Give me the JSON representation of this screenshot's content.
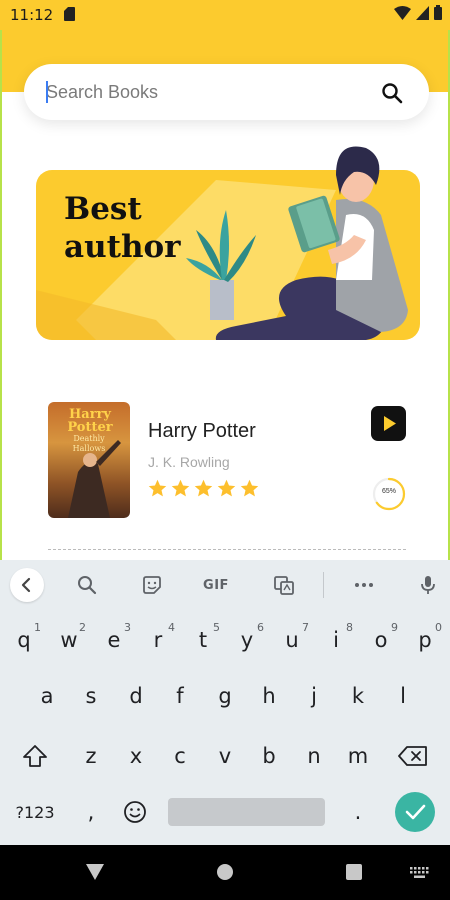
{
  "status_bar": {
    "time": "11:12"
  },
  "search": {
    "placeholder": "Search Books"
  },
  "banner": {
    "title_line1": "Best",
    "title_line2": "author"
  },
  "book": {
    "title": "Harry Potter",
    "author": "J. K. Rowling",
    "rating": 5,
    "progress_label": "65%",
    "progress_fraction": 0.65,
    "cover_title_line1": "Harry",
    "cover_title_line2": "Potter",
    "cover_subtitle": "Deathly Hallows"
  },
  "keyboard": {
    "gif_label": "GIF",
    "row1": [
      {
        "key": "q",
        "hint": "1"
      },
      {
        "key": "w",
        "hint": "2"
      },
      {
        "key": "e",
        "hint": "3"
      },
      {
        "key": "r",
        "hint": "4"
      },
      {
        "key": "t",
        "hint": "5"
      },
      {
        "key": "y",
        "hint": "6"
      },
      {
        "key": "u",
        "hint": "7"
      },
      {
        "key": "i",
        "hint": "8"
      },
      {
        "key": "o",
        "hint": "9"
      },
      {
        "key": "p",
        "hint": "0"
      }
    ],
    "row2": [
      "a",
      "s",
      "d",
      "f",
      "g",
      "h",
      "j",
      "k",
      "l"
    ],
    "row3": [
      "z",
      "x",
      "c",
      "v",
      "b",
      "n",
      "m"
    ],
    "symbols_label": "?123",
    "comma": ",",
    "period": "."
  },
  "colors": {
    "accent_yellow": "#fccb2e",
    "star_yellow": "#fdbf2d",
    "enter_teal": "#3ab5a3"
  }
}
